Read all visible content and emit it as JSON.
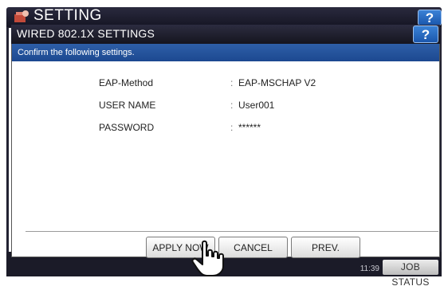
{
  "app": {
    "title": "SETTING",
    "help": "?"
  },
  "dialog": {
    "title": "WIRED 802.1X SETTINGS",
    "help": "?",
    "banner": "Confirm the following settings.",
    "rows": [
      {
        "label": "EAP-Method",
        "sep": ":",
        "value": "EAP-MSCHAP V2"
      },
      {
        "label": "USER NAME",
        "sep": ":",
        "value": "User001"
      },
      {
        "label": "PASSWORD",
        "sep": ":",
        "value": "******"
      }
    ],
    "buttons": {
      "apply": "APPLY NOW",
      "cancel": "CANCEL",
      "prev": "PREV."
    }
  },
  "footer": {
    "time": "11:39",
    "job_status": "JOB STATUS"
  }
}
